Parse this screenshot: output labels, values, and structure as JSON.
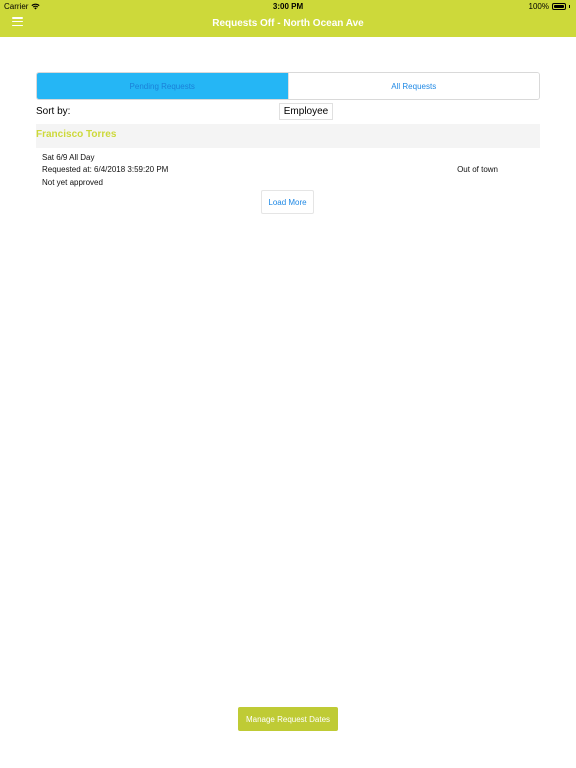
{
  "status_bar": {
    "carrier": "Carrier",
    "time": "3:00 PM",
    "battery": "100%"
  },
  "header": {
    "title": "Requests Off - North Ocean Ave",
    "menu_icon": "hamburger-menu-icon",
    "color": "#cdd93a"
  },
  "tabs": [
    {
      "label": "Pending Requests",
      "active": true
    },
    {
      "label": "All Requests",
      "active": false
    }
  ],
  "sort": {
    "label": "Sort by:",
    "value": "Employee"
  },
  "groups": [
    {
      "name": "Francisco Torres",
      "requests": [
        {
          "date": "Sat 6/9 All Day",
          "requested_at": "Requested at: 6/4/2018 3:59:20 PM",
          "status": "Not yet approved",
          "reason": "Out of town"
        }
      ]
    }
  ],
  "load_more_label": "Load More",
  "manage_button_label": "Manage Request Dates",
  "colors": {
    "accent": "#cdd93a",
    "tab_active": "#25b6f5",
    "link": "#1e88e5"
  }
}
